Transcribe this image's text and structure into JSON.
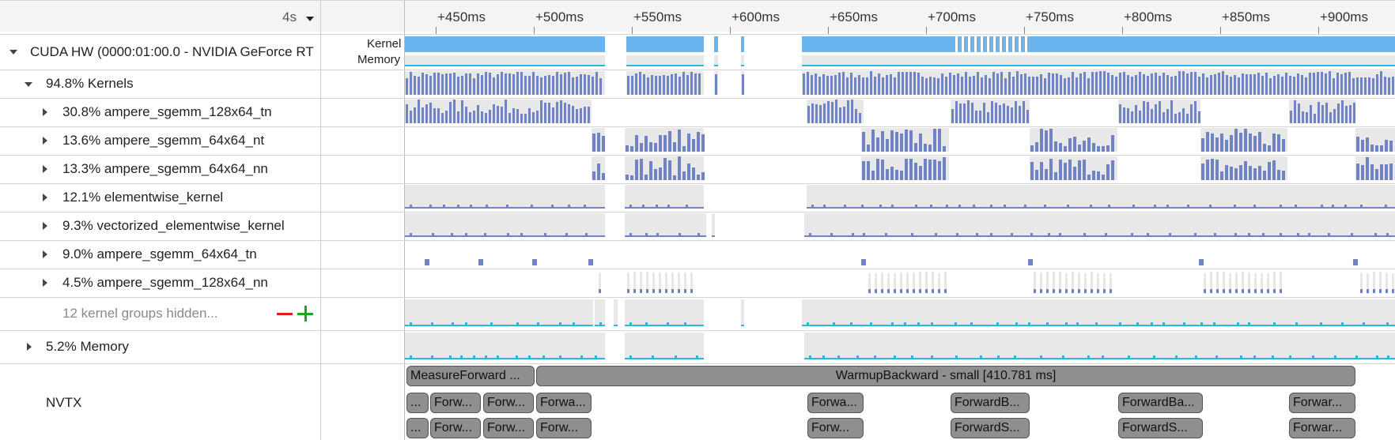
{
  "toolbar": {
    "zoom_label": "4s"
  },
  "timeline": {
    "ticks": [
      "+450ms",
      "+500ms",
      "+550ms",
      "+600ms",
      "+650ms",
      "+700ms",
      "+750ms",
      "+800ms",
      "+850ms",
      "+900ms"
    ]
  },
  "device_row": {
    "label": "CUDA HW (0000:01:00.0 - NVIDIA GeForce RT",
    "legend_kernel": "Kernel",
    "legend_memory": "Memory"
  },
  "rows": [
    {
      "label": "94.8% Kernels"
    },
    {
      "label": "30.8% ampere_sgemm_128x64_tn"
    },
    {
      "label": "13.6% ampere_sgemm_64x64_nt"
    },
    {
      "label": "13.3% ampere_sgemm_64x64_nn"
    },
    {
      "label": "12.1% elementwise_kernel"
    },
    {
      "label": "9.3% vectorized_elementwise_kernel"
    },
    {
      "label": "9.0% ampere_sgemm_64x64_tn"
    },
    {
      "label": "4.5% ampere_sgemm_128x64_nn"
    }
  ],
  "hidden_groups": {
    "label": "12 kernel groups hidden...",
    "minus": "—",
    "plus": "+"
  },
  "memory_row": {
    "label": "5.2% Memory"
  },
  "nvtx": {
    "label": "NVTX",
    "ranges_top": [
      {
        "text": "MeasureForward ..."
      },
      {
        "text": "WarmupBackward - small [410.781 ms]"
      }
    ],
    "ranges_mid": [
      {
        "text": "..."
      },
      {
        "text": "Forw..."
      },
      {
        "text": "Forw..."
      },
      {
        "text": "Forwa..."
      },
      {
        "text": "Forwa..."
      },
      {
        "text": "ForwardB..."
      },
      {
        "text": "ForwardBa..."
      },
      {
        "text": "Forwar..."
      }
    ],
    "ranges_bot": [
      {
        "text": "..."
      },
      {
        "text": "Forw..."
      },
      {
        "text": "Forw..."
      },
      {
        "text": "Forw..."
      },
      {
        "text": "Forw..."
      },
      {
        "text": "ForwardS..."
      },
      {
        "text": "ForwardS..."
      },
      {
        "text": "Forwar..."
      }
    ]
  },
  "colors": {
    "kernel_bar": "#6f83c6",
    "kernel_bright": "#6ab4ef",
    "memory_bar": "#2bb7e0",
    "lane_bg": "#e8e8e8",
    "minus": "#e21b1b",
    "plus": "#1ea81e"
  }
}
